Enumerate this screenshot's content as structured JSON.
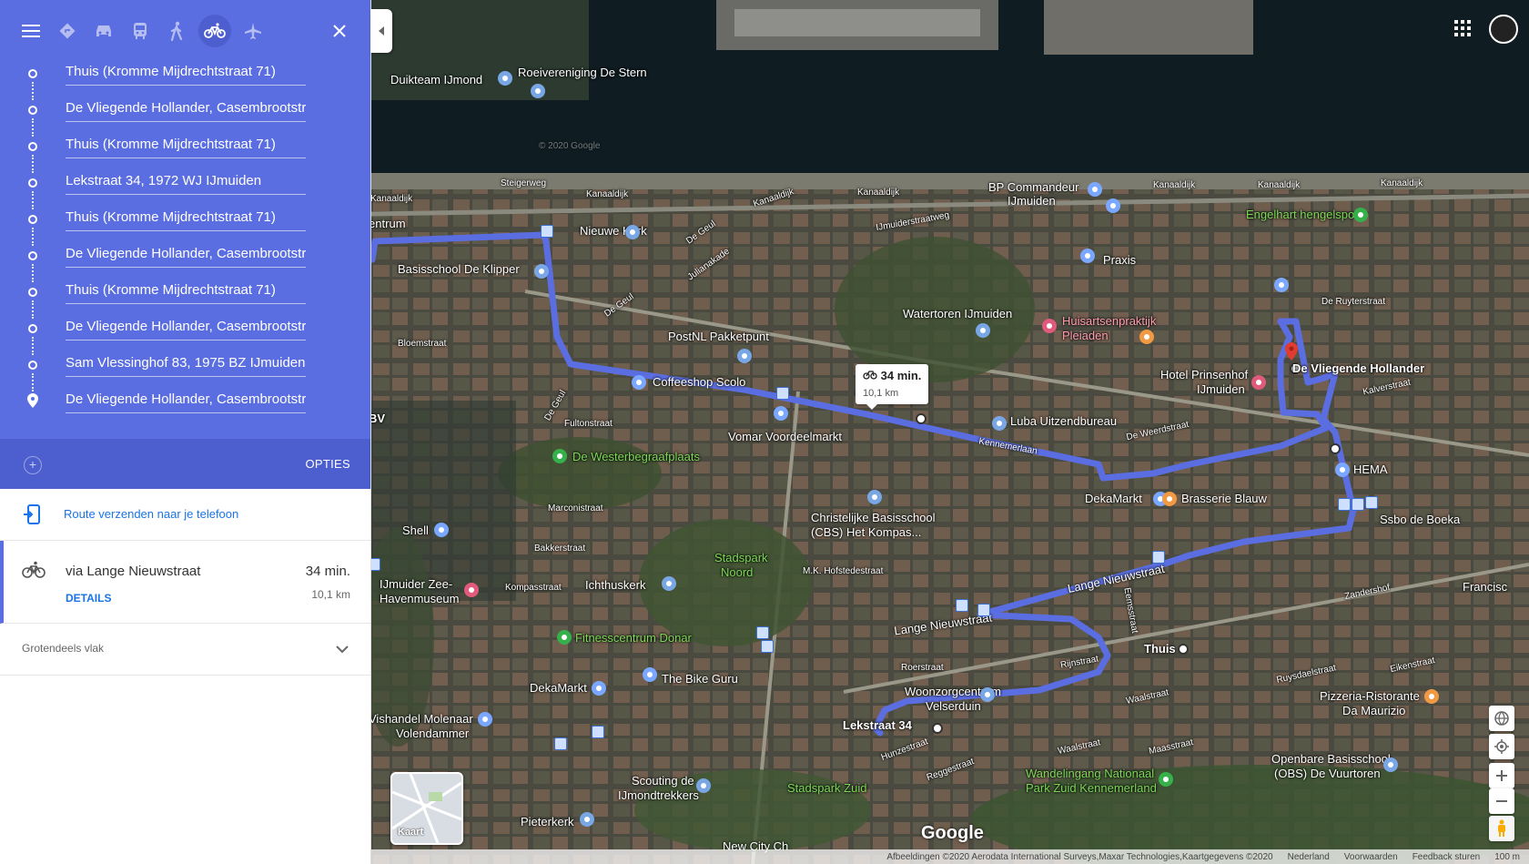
{
  "colors": {
    "header": "#5b6ee1",
    "route": "#5b6ee1",
    "link": "#1a73e8"
  },
  "modes": [
    "directions-icon",
    "car-icon",
    "transit-icon",
    "walk-icon",
    "bicycle-icon",
    "flight-icon"
  ],
  "waypoints": [
    "Thuis (Kromme Mijdrechtstraat 71)",
    "De Vliegende Hollander, Casembrootstraat",
    "Thuis (Kromme Mijdrechtstraat 71)",
    "Lekstraat 34, 1972 WJ IJmuiden",
    "Thuis (Kromme Mijdrechtstraat 71)",
    "De Vliegende Hollander, Casembrootstraat",
    "Thuis (Kromme Mijdrechtstraat 71)",
    "De Vliegende Hollander, Casembrootstraat",
    "Sam Vlessinghof 83, 1975 BZ IJmuiden",
    "De Vliegende Hollander, Casembrootstraat"
  ],
  "options_label": "OPTIES",
  "send_label": "Route verzenden naar je telefoon",
  "route": {
    "via": "via Lange Nieuwstraat",
    "time": "34 min.",
    "distance": "10,1 km",
    "details_label": "DETAILS"
  },
  "flat_label": "Grotendeels vlak",
  "map": {
    "callout_time": "34 min.",
    "callout_distance": "10,1 km",
    "labels": {
      "duikteam": "Duikteam IJmond",
      "roeivereniging": "Roeivereniging De Stern",
      "steigerweg": "Steigerweg",
      "kanaaldijk1": "Kanaaldijk",
      "kanaaldijk2": "Kanaaldijk",
      "kanaaldijk3": "Kanaaldijk",
      "kanaaldijk4": "Kanaaldijk",
      "kanaaldijk5": "Kanaaldijk",
      "kanaaldijk6": "Kanaaldijk",
      "kanaaldijk7": "Kanaaldijk",
      "bp": "BP Commandeur",
      "bp2": "IJmuiden",
      "engelhart": "Engelhart hengelsport",
      "nieuwekerk": "Nieuwe Kerk",
      "praxis": "Praxis",
      "zorgcentrum": "rgcentrum",
      "basisschool": "Basisschool De Klipper",
      "watertoren": "Watertoren IJmuiden",
      "huisarts1": "Huisartsenpraktijk",
      "huisarts2": "Pleiaden",
      "postnl": "PostNL Pakketpunt",
      "hotel1": "Hotel Prinsenhof",
      "hotel2": "IJmuiden",
      "vliegende": "De Vliegende Hollander",
      "coffeeshop": "Coffeeshop Scolo",
      "luba": "Luba Uitzendbureau",
      "vomar": "Vomar Voordeelmarkt",
      "westerbegraaf": "De Westerbegraafplaats",
      "hema": "HEMA",
      "dekamarkt1": "DekaMarkt",
      "brasserie": "Brasserie Blauw",
      "ssbo": "Ssbo de Boeka",
      "christelijke1": "Christelijke Basisschool",
      "christelijke2": "(CBS) Het Kompas...",
      "shell": "Shell",
      "stadspark1": "Stadspark",
      "stadspark2": "Noord",
      "ijmuider1": "IJmuider Zee-",
      "ijmuider2": "Havenmuseum",
      "ichthuskerk": "Ichthuskerk",
      "thuis": "Thuis",
      "fitness": "Fitnesscentrum Donar",
      "dekamarkt2": "DekaMarkt",
      "bikeguru": "The Bike Guru",
      "woonzorg1": "Woonzorgcentrum",
      "woonzorg2": "Velserduin",
      "lekstraat": "Lekstraat 34",
      "pizzeria1": "Pizzeria-Ristorante",
      "pizzeria2": "Da Maurizio",
      "vishandel1": "Vishandel Molenaar",
      "vishandel2": "Volendammer",
      "openbare1": "Openbare Basisschool",
      "openbare2": "(OBS) De Vuurtoren",
      "scouting1": "Scouting de",
      "scouting2": "IJmondtrekkers",
      "stadsparkzuid": "Stadspark Zuid",
      "wandel1": "Wandelingang Nationaal",
      "wandel2": "Park Zuid Kennemerland",
      "pieterkerk": "Pieterkerk",
      "newcity": "New City Ch",
      "francisc": "Francisc",
      "bv": "BV",
      "lange1": "Lange Nieuwstraat",
      "lange2": "Lange Nieuwstraat",
      "kennemerlaan": "Kennemerlaan",
      "degeul1": "De Geul",
      "degeul2": "De Geul",
      "degeul3": "De Geul",
      "fultonstraat": "Fultonstraat",
      "marconistraat": "Marconistraat",
      "kompasstraat": "Kompasstraat",
      "bakkerstraat": "Bakkerstraat",
      "hofstede": "M.K. Hofstedestraat",
      "rijnstraat": "Rijnstraat",
      "roerstraat": "Roerstraat",
      "waalstraat": "Waalstraat",
      "maasstraat": "Maasstraat",
      "hunzestraat": "Hunzestraat",
      "reggestraat": "Reggestraat",
      "eemsstraat": "Eemsstraat",
      "ruyterstraat": "De Ruyterstraat",
      "weerdstraat": "De Weerdstraat",
      "kalverstraat": "Kalverstraat",
      "zandershof": "Zandershof",
      "ruysdael": "Ruysdaelstraat",
      "eikenstraat": "Eikenstraat",
      "ijmuiderstraatweg": "IJmuiderstraatweg",
      "julianakade": "Julianakade",
      "bloemstraat": "Bloemstraat",
      "watermark": "© 2020 Google",
      "google": "Google",
      "kaart": "Kaart"
    },
    "attribution": [
      "Afbeeldingen ©2020 Aerodata International Surveys,Maxar Technologies,Kaartgegevens ©2020",
      "Nederland",
      "Voorwaarden",
      "Feedback sturen",
      "100 m"
    ]
  }
}
